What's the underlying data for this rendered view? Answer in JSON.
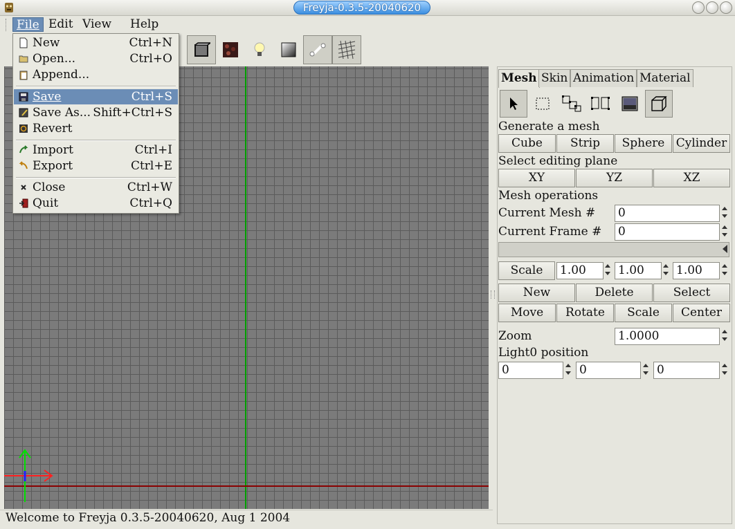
{
  "window": {
    "title": "Freyja-0.3.5-20040620"
  },
  "menubar": {
    "items": [
      {
        "label": "File",
        "active": true
      },
      {
        "label": "Edit"
      },
      {
        "label": "View"
      },
      {
        "label": "Help"
      }
    ]
  },
  "file_menu": {
    "items": [
      {
        "label": "New",
        "accel": "Ctrl+N",
        "icon": "new-file-icon"
      },
      {
        "label": "Open...",
        "accel": "Ctrl+O",
        "icon": "folder-open-icon"
      },
      {
        "label": "Append...",
        "accel": "",
        "icon": "clipboard-icon"
      },
      {
        "label": "Save",
        "accel": "Ctrl+S",
        "icon": "floppy-save-icon",
        "highlighted": true
      },
      {
        "label": "Save As...",
        "accel": "Shift+Ctrl+S",
        "icon": "save-as-icon"
      },
      {
        "label": "Revert",
        "accel": "",
        "icon": "revert-icon"
      },
      {
        "label": "Import",
        "accel": "Ctrl+I",
        "icon": "import-arrow-icon"
      },
      {
        "label": "Export",
        "accel": "Ctrl+E",
        "icon": "export-arrow-icon"
      },
      {
        "label": "Close",
        "accel": "Ctrl+W",
        "icon": "close-x-icon"
      },
      {
        "label": "Quit",
        "accel": "Ctrl+Q",
        "icon": "quit-door-icon"
      }
    ]
  },
  "toolbar": {
    "icons": [
      "cube-view-icon",
      "texture-icon",
      "light-bulb-icon",
      "material-gradient-icon",
      "bone-icon",
      "wireframe-grid-icon"
    ]
  },
  "status": {
    "text": "Welcome to Freyja 0.3.5-20040620, Aug  1 2004"
  },
  "panel": {
    "tabs": [
      "Mesh",
      "Skin",
      "Animation",
      "Material"
    ],
    "tool_icons": [
      "select-arrow-icon",
      "marquee-select-icon",
      "vertex-group-icon",
      "vertex-split-icon",
      "image-texture-icon",
      "cube-outline-icon"
    ],
    "generate_label": "Generate a mesh",
    "generate_buttons": [
      "Cube",
      "Strip",
      "Sphere",
      "Cylinder"
    ],
    "plane_label": "Select editing plane",
    "plane_buttons": [
      "XY",
      "YZ",
      "XZ"
    ],
    "mesh_ops_label": "Mesh operations",
    "current_mesh_label": "Current Mesh #",
    "current_mesh_value": "0",
    "current_frame_label": "Current Frame #",
    "current_frame_value": "0",
    "scale_button": "Scale",
    "scale_values": [
      "1.00",
      "1.00",
      "1.00"
    ],
    "ops_row1": [
      "New",
      "Delete",
      "Select"
    ],
    "ops_row2": [
      "Move",
      "Rotate",
      "Scale",
      "Center"
    ],
    "zoom_label": "Zoom",
    "zoom_value": "1.0000",
    "light_label": "Light0 position",
    "light_values": [
      "0",
      "0",
      "0"
    ]
  }
}
